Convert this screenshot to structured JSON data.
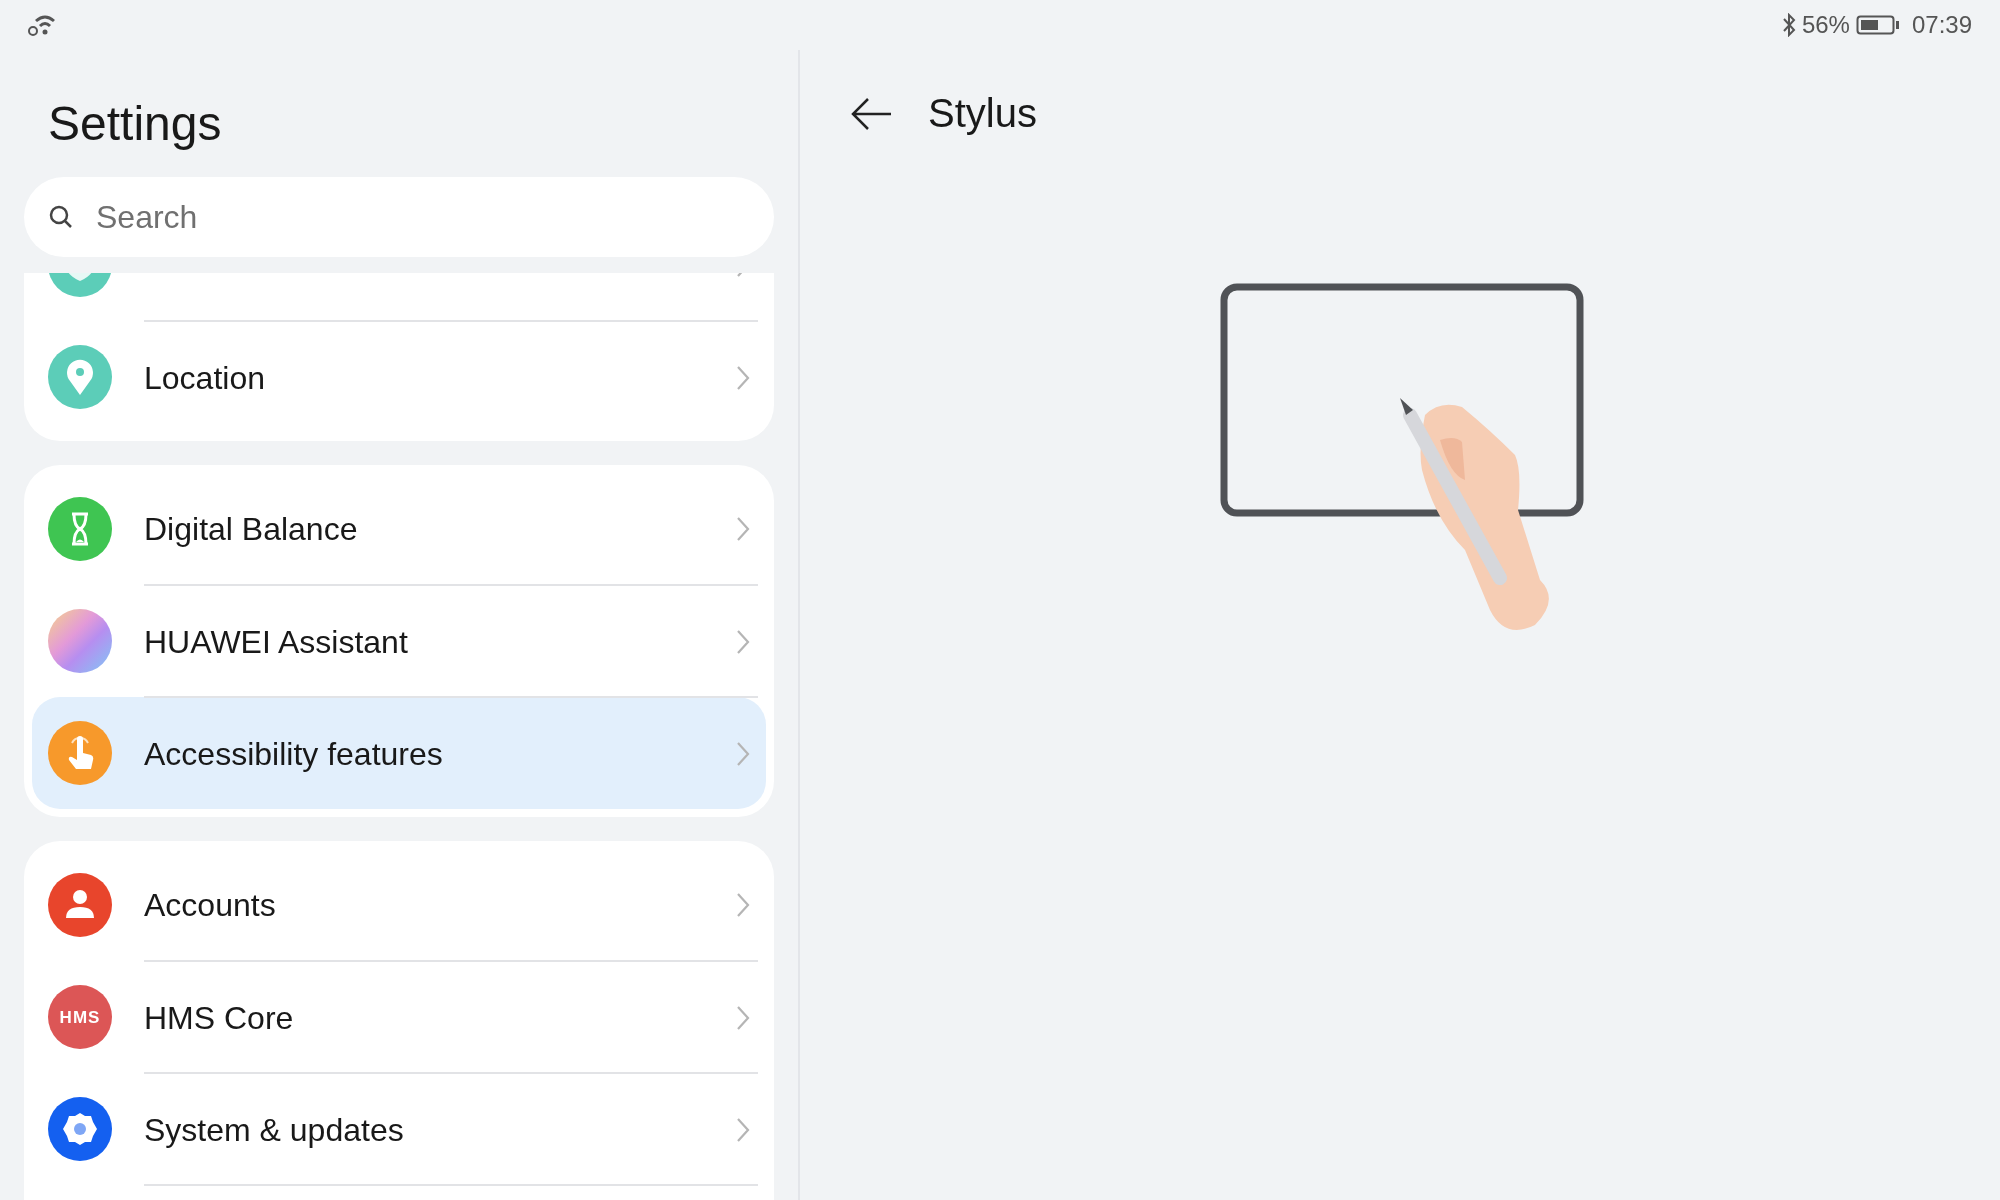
{
  "status_bar": {
    "battery_percent": "56%",
    "time": "07:39"
  },
  "settings": {
    "title": "Settings",
    "search": {
      "placeholder": "Search"
    },
    "groups": [
      {
        "items": [
          {
            "kind": "shield",
            "color": "#5ccdb8",
            "selected": false
          },
          {
            "label": "Location",
            "kind": "pin",
            "color": "#5ccdb8",
            "selected": false
          }
        ]
      },
      {
        "items": [
          {
            "label": "Digital Balance",
            "kind": "hourglass",
            "color": "#3fc552",
            "selected": false
          },
          {
            "label": "HUAWEI Assistant",
            "kind": "gradient",
            "selected": false
          },
          {
            "label": "Accessibility features",
            "kind": "hand",
            "color": "#f7992b",
            "selected": true
          }
        ]
      },
      {
        "items": [
          {
            "label": "Accounts",
            "kind": "person",
            "color": "#e8452c",
            "selected": false
          },
          {
            "label": "HMS Core",
            "kind": "text",
            "icon_text": "HMS",
            "color": "#dc5656",
            "selected": false
          },
          {
            "label": "System & updates",
            "kind": "gear",
            "color": "#1460f0",
            "selected": false
          },
          {
            "kind": "blank",
            "selected": false
          }
        ]
      }
    ]
  },
  "detail": {
    "title": "Stylus"
  }
}
